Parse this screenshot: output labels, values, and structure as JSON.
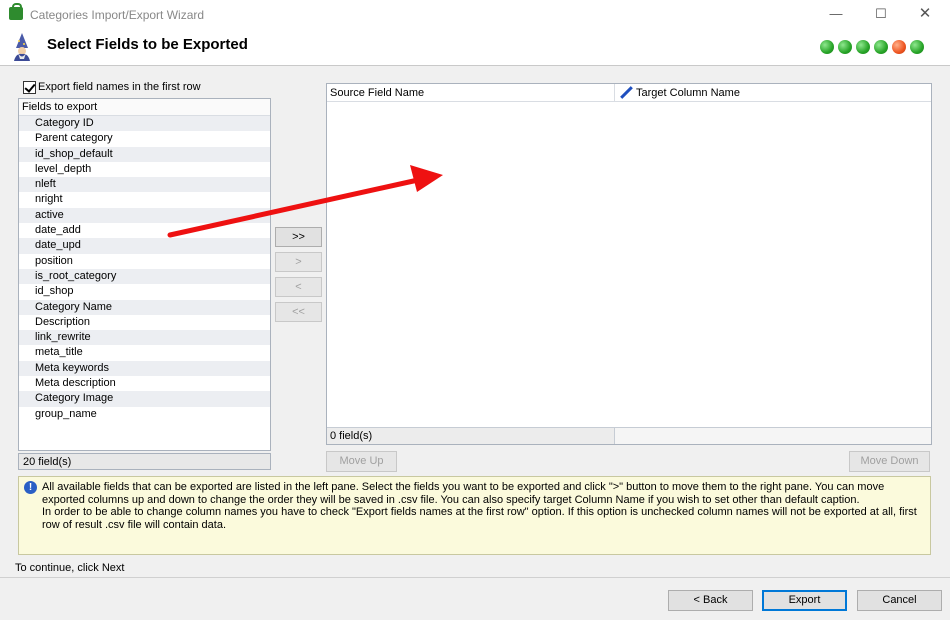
{
  "window": {
    "title": "Categories Import/Export Wizard",
    "min_glyph": "—",
    "max_glyph": "☐",
    "close_glyph": "✕"
  },
  "header": {
    "title": "Select Fields to be Exported",
    "steps": [
      "done",
      "done",
      "done",
      "done",
      "current",
      "pending"
    ]
  },
  "options": {
    "export_field_names_label": "Export field names in the  first row",
    "export_field_names_checked": true
  },
  "left_pane": {
    "header": "Fields to export",
    "fields": [
      "Category ID",
      "Parent category",
      "id_shop_default",
      "level_depth",
      "nleft",
      "nright",
      "active",
      "date_add",
      "date_upd",
      "position",
      "is_root_category",
      "id_shop",
      "Category Name",
      "Description",
      "link_rewrite",
      "meta_title",
      "Meta keywords",
      "Meta description",
      "Category Image",
      "group_name"
    ],
    "count": "20 field(s)"
  },
  "move_buttons": {
    "add_all": ">>",
    "add": ">",
    "remove": "<",
    "remove_all": "<<"
  },
  "right_pane": {
    "source_header": "Source Field Name",
    "target_header": "Target Column Name",
    "count": "0 field(s)"
  },
  "reorder": {
    "move_up": "Move Up",
    "move_down": "Move Down"
  },
  "info": {
    "paragraph1": "All available fields that can be exported are listed in the left pane. Select the fields you want to be exported and click \">\" button to move them to the right pane. You can move exported columns up and down to change the order they will be saved in .csv file. You can also specify target Column Name if you wish to set other than default caption.",
    "paragraph2": "In order to be able to change column names you have to check \"Export fields names at the first row\" option. If this option is unchecked column names will not be exported at all, first row of result .csv file will contain data."
  },
  "status": {
    "continue_text": "To continue, click Next"
  },
  "footer": {
    "back": "< Back",
    "export": "Export",
    "cancel": "Cancel"
  },
  "colors": {
    "annotation_arrow": "#ee1111",
    "step_done": "#28a428",
    "step_current": "#ee5420"
  }
}
